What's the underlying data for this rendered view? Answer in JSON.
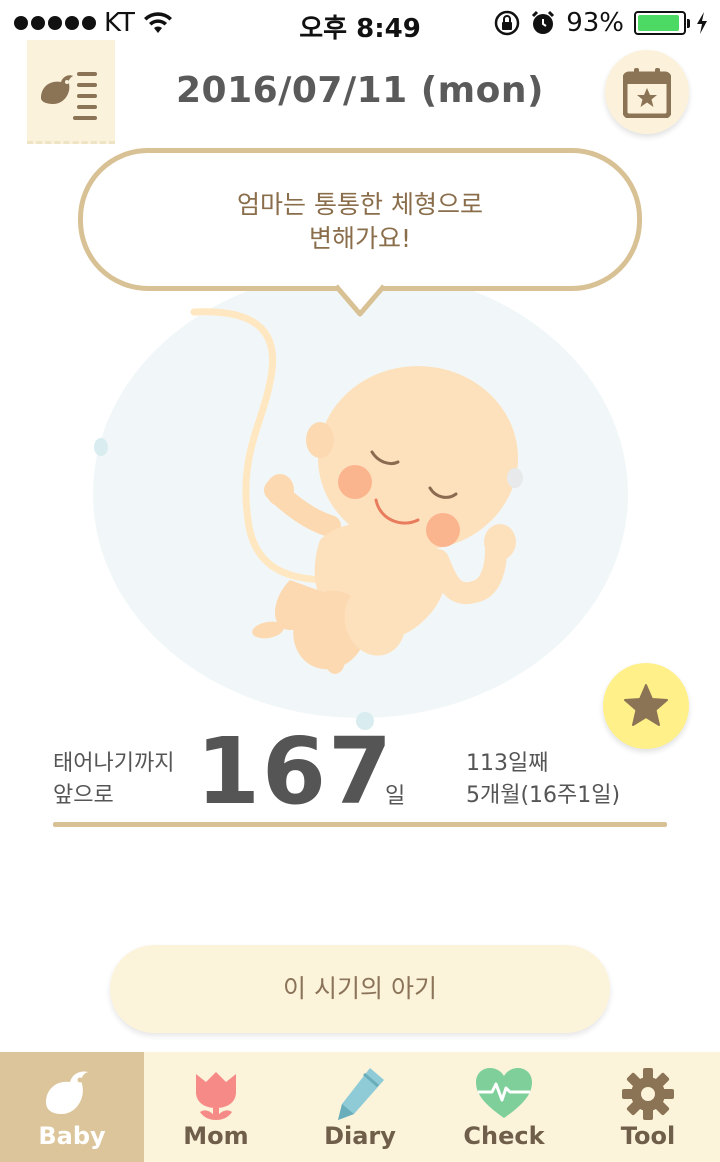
{
  "status_bar": {
    "carrier": "KT",
    "time": "오후 8:49",
    "battery_percent": "93%",
    "battery_level": 0.93
  },
  "header": {
    "date": "2016/07/11 (mon)",
    "menu_icon": "bird-list-icon",
    "calendar_icon": "calendar-star-icon"
  },
  "speech_bubble": {
    "line1": "엄마는 통통한 체형으로",
    "line2": "변해가요!"
  },
  "countdown": {
    "label_line1": "태어나기까지",
    "label_line2": "앞으로",
    "days_left": "167",
    "unit": "일",
    "info_line1": "113일째",
    "info_line2": "5개월(16주1일)"
  },
  "baby_period_button": {
    "label": "이 시기의 아기"
  },
  "tabs": [
    {
      "label": "Baby",
      "icon": "bird-icon",
      "active": true
    },
    {
      "label": "Mom",
      "icon": "tulip-icon",
      "active": false
    },
    {
      "label": "Diary",
      "icon": "pencil-icon",
      "active": false
    },
    {
      "label": "Check",
      "icon": "heart-pulse-icon",
      "active": false
    },
    {
      "label": "Tool",
      "icon": "gear-icon",
      "active": false
    }
  ],
  "colors": {
    "accent_gold": "#d8c194",
    "cream": "#fcf3db",
    "tab_active": "#dcc59b",
    "star_yellow": "#fff08a"
  }
}
